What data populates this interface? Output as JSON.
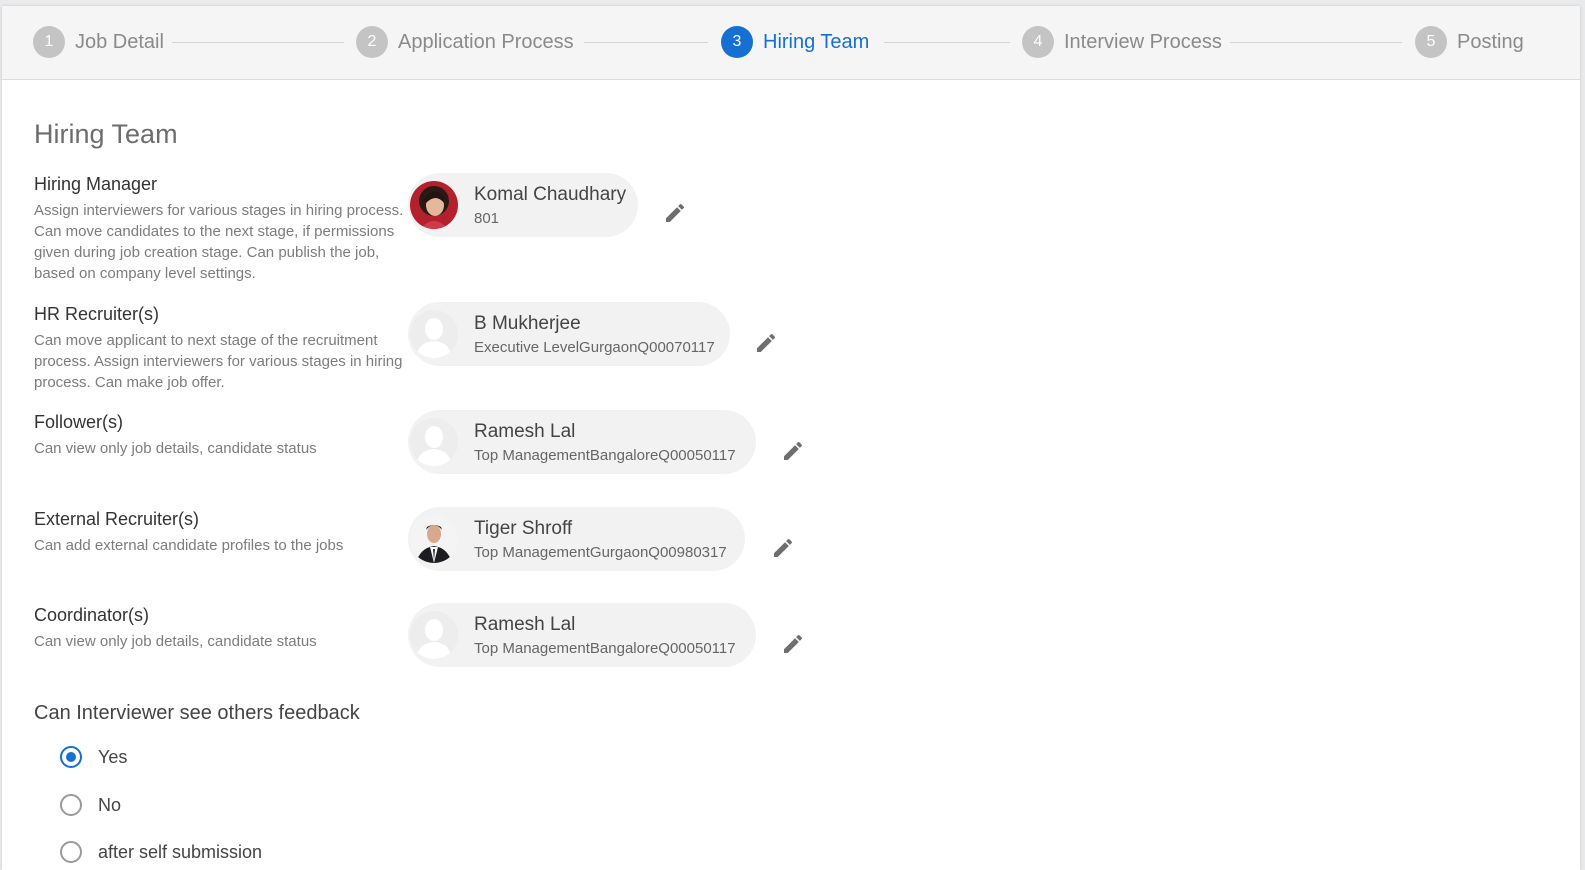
{
  "stepper": {
    "steps": [
      {
        "num": "1",
        "label": "Job Detail"
      },
      {
        "num": "2",
        "label": "Application Process"
      },
      {
        "num": "3",
        "label": "Hiring Team"
      },
      {
        "num": "4",
        "label": "Interview Process"
      },
      {
        "num": "5",
        "label": "Posting"
      }
    ],
    "active_step": 3
  },
  "section_title": "Hiring Team",
  "roles": [
    {
      "name": "Hiring Manager",
      "description": "Assign interviewers for various stages in hiring process. Can move candidates to the next stage, if permissions given during job creation stage. Can publish the job, based on company level settings.",
      "member": {
        "name": "Komal Chaudhary",
        "sub": "801",
        "avatar": "photo-woman"
      }
    },
    {
      "name": "HR Recruiter(s)",
      "description": "Can move applicant to next stage of the recruitment process. Assign interviewers for various stages in hiring process. Can make job offer.",
      "member": {
        "name": "B Mukherjee",
        "sub": "Executive LevelGurgaonQ00070117",
        "avatar": "placeholder"
      }
    },
    {
      "name": "Follower(s)",
      "description": "Can view only job details, candidate status",
      "member": {
        "name": "Ramesh Lal",
        "sub": "Top ManagementBangaloreQ00050117",
        "avatar": "placeholder"
      }
    },
    {
      "name": "External Recruiter(s)",
      "description": "Can add external candidate profiles to the jobs",
      "member": {
        "name": "Tiger Shroff",
        "sub": "Top ManagementGurgaonQ00980317",
        "avatar": "photo-man-suit"
      }
    },
    {
      "name": "Coordinator(s)",
      "description": "Can view only job details, candidate status",
      "member": {
        "name": "Ramesh Lal",
        "sub": "Top ManagementBangaloreQ00050117",
        "avatar": "placeholder"
      }
    }
  ],
  "feedback": {
    "question": "Can Interviewer see others feedback",
    "options": [
      "Yes",
      "No",
      "after self submission"
    ],
    "selected": "Yes"
  },
  "colors": {
    "accent": "#1670d4",
    "inactive_step": "#c4c4c4"
  },
  "icons": {
    "edit": "pencil-icon",
    "avatar_placeholder": "user-placeholder-icon"
  }
}
